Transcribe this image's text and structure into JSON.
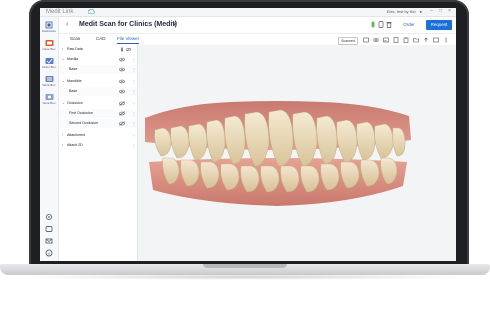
{
  "window": {
    "app_title": "Medit Link",
    "user_label": "Elec. test by Kiri"
  },
  "leftnav": {
    "items": [
      {
        "label": "Dashboard",
        "icon": "dashboard-icon"
      },
      {
        "label": "Case Box",
        "icon": "case-box-icon"
      },
      {
        "label": "Order Box",
        "icon": "order-box-icon"
      },
      {
        "label": "Work Box",
        "icon": "work-box-icon"
      },
      {
        "label": "Work Box",
        "icon": "work-box-icon"
      }
    ]
  },
  "header": {
    "title": "Medit Scan for Clinics (Medit)",
    "order_label": "Order",
    "request_label": "Request"
  },
  "tabs": [
    {
      "label": "Scan"
    },
    {
      "label": "CAD"
    },
    {
      "label": "File Viewer"
    }
  ],
  "toolbar": {
    "scanned_label": "Scanned"
  },
  "tree": [
    {
      "label": "Raw Data",
      "level": 0,
      "expanded": false
    },
    {
      "label": "Maxilla",
      "level": 0,
      "expanded": true
    },
    {
      "label": "Base",
      "level": 1
    },
    {
      "label": "Mandible",
      "level": 0,
      "expanded": true
    },
    {
      "label": "Base",
      "level": 1
    },
    {
      "label": "Occlusion",
      "level": 0,
      "expanded": true
    },
    {
      "label": "First Occlusion",
      "level": 1
    },
    {
      "label": "Second Occlusion",
      "level": 1
    },
    {
      "label": "Attachment",
      "level": 0,
      "expanded": false
    },
    {
      "label": "Attach 2D",
      "level": 0,
      "expanded": false
    }
  ],
  "colors": {
    "accent": "#1b6fd8",
    "gum": "#d9897e",
    "tooth": "#efe2c2"
  }
}
